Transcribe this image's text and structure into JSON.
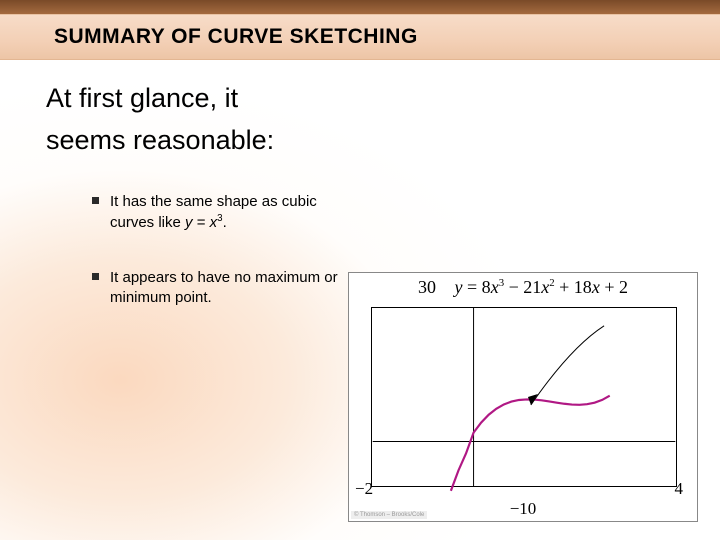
{
  "title": "SUMMARY OF CURVE SKETCHING",
  "lead_line1": "At first glance, it",
  "lead_line2": "seems reasonable:",
  "bullet1_pre": "It has the same shape as cubic curves like ",
  "bullet1_eq_var": "y",
  "bullet1_eq_mid": " = ",
  "bullet1_eq_x": "x",
  "bullet1_eq_pow": "3",
  "bullet1_post": ".",
  "bullet2": "It appears to have no maximum or minimum point.",
  "figure": {
    "ymax_label": "30",
    "equation": "y = 8x³ − 21x² + 18x + 2",
    "xmin_label": "−2",
    "xmax_label": "4",
    "ymin_label": "−10",
    "credit": "© Thomson – Brooks/Cole"
  },
  "chart_data": {
    "type": "line",
    "title": "y = 8x^3 - 21x^2 + 18x + 2",
    "xlabel": "",
    "ylabel": "",
    "xlim": [
      -2,
      4
    ],
    "ylim": [
      -10,
      30
    ],
    "annotations": [
      {
        "type": "arrow",
        "to_x": 1.05,
        "to_y": 7.2,
        "from_x": 2.6,
        "from_y": 26
      }
    ],
    "series": [
      {
        "name": "curve",
        "x": [
          -0.45,
          -0.3,
          -0.15,
          0,
          0.15,
          0.3,
          0.45,
          0.6,
          0.75,
          0.9,
          1.05,
          1.2,
          1.35,
          1.5,
          1.65,
          1.8,
          1.95,
          2.1,
          2.25,
          2.4,
          2.55,
          2.7
        ],
        "y": [
          -11.08,
          -6.51,
          -2.7,
          2.0,
          4.25,
          6.02,
          7.36,
          8.33,
          8.97,
          9.33,
          9.46,
          9.42,
          9.25,
          9.0,
          8.73,
          8.48,
          8.3,
          8.25,
          8.38,
          8.72,
          9.35,
          10.29
        ]
      }
    ]
  }
}
